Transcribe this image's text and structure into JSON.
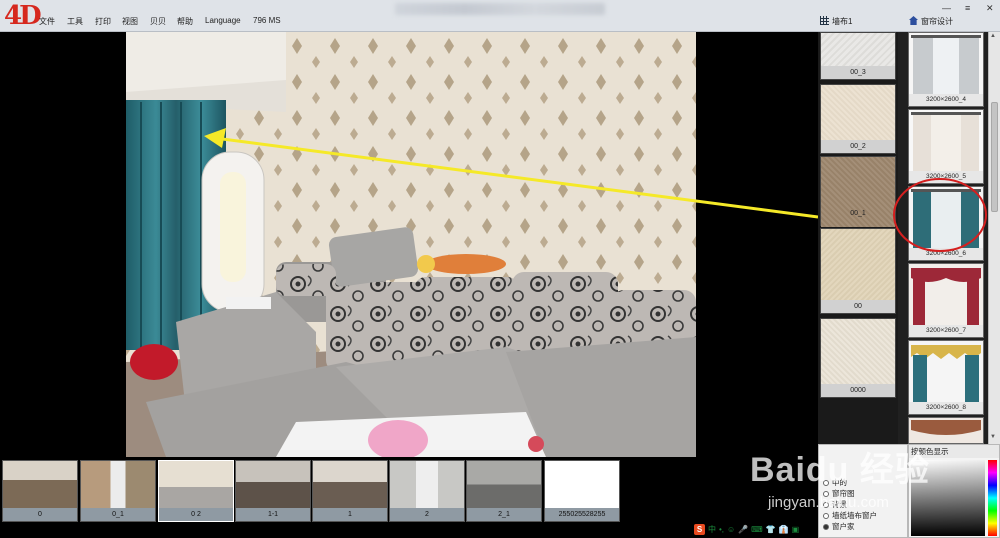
{
  "app": {
    "logo": "4D",
    "menu": [
      "文件",
      "工具",
      "打印",
      "视图",
      "贝贝",
      "帮助",
      "Language",
      "796 MS"
    ],
    "window_controls": [
      "—",
      "≡",
      "✕"
    ]
  },
  "panels": {
    "swatch_title": "墙布1",
    "curtain_title": "窗帘设计"
  },
  "swatches": [
    {
      "label": "00_3",
      "color": "#e9e8e6"
    },
    {
      "label": "00_2",
      "color": "#ece2d2"
    },
    {
      "label": "00_1",
      "color": "#a48f78"
    },
    {
      "label": "00",
      "color": "#e3d7bd"
    },
    {
      "label": "0000",
      "color": "#ece6da"
    }
  ],
  "curtains": [
    {
      "label": "3200×2600_4",
      "color": "#cfd3d6"
    },
    {
      "label": "3200×2600_5",
      "color": "#e9e2da"
    },
    {
      "label": "3200×2600_6",
      "color": "#2e6d78"
    },
    {
      "label": "3200×2600_7",
      "color": "#9d2838"
    },
    {
      "label": "3200×2600_8",
      "color": "#2c6f7c"
    },
    {
      "label": "",
      "color": "#9a5b3e"
    }
  ],
  "thumbnails": [
    {
      "label": "0",
      "color": "#7c6a56"
    },
    {
      "label": "0_1",
      "color": "#b79b7d"
    },
    {
      "label": "0 2",
      "color": "#c9bfae"
    },
    {
      "label": "1-1",
      "color": "#5d5249"
    },
    {
      "label": "1",
      "color": "#6a5d52"
    },
    {
      "label": "2",
      "color": "#9b9b97"
    },
    {
      "label": "2_1",
      "color": "#6c6c6a"
    },
    {
      "label": "255025528255",
      "color": "#ffffff"
    }
  ],
  "layer_panel": {
    "items": [
      "中的",
      "窗帘图",
      "背景",
      "墙纸墙布窗户",
      "窗户家"
    ]
  },
  "color_panel": {
    "title": "按颜色显示"
  },
  "ime": {
    "items": [
      "中",
      "•,",
      "☺",
      "🎤",
      "⌨",
      "👕",
      "👔",
      "▣"
    ]
  },
  "watermark": {
    "line1": "Baidu 经验",
    "line2": "jingyan.baidu.com"
  },
  "colors": {
    "menubar_bg": "#dfe3e8",
    "logo": "#d6281e",
    "arrow": "#f5e928",
    "highlight_circle": "#d41f1f"
  }
}
